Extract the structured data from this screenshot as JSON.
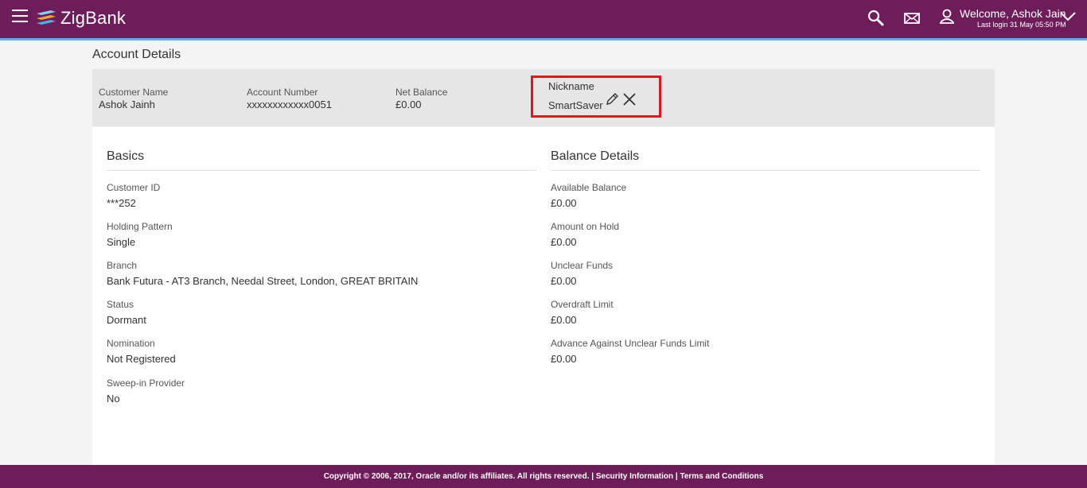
{
  "header": {
    "brand": "ZigBank",
    "welcome": "Welcome, Ashok Jain",
    "last_login": "Last login 31 May 05:50 PM",
    "colors": {
      "bar": "#6f1c5a",
      "accent_line": "#5fb0e8"
    }
  },
  "page": {
    "title": "Account Details"
  },
  "summary": {
    "customer_name_label": "Customer Name",
    "customer_name": "Ashok Jainh",
    "account_number_label": "Account Number",
    "account_number": "xxxxxxxxxxxx0051",
    "net_balance_label": "Net Balance",
    "net_balance": "£0.00",
    "nickname_label": "Nickname",
    "nickname": "SmartSaver"
  },
  "basics": {
    "title": "Basics",
    "fields": [
      {
        "label": "Customer ID",
        "value": "***252"
      },
      {
        "label": "Holding Pattern",
        "value": "Single"
      },
      {
        "label": "Branch",
        "value": "Bank Futura - AT3 Branch, Needal Street, London, GREAT BRITAIN"
      },
      {
        "label": "Status",
        "value": "Dormant"
      },
      {
        "label": "Nomination",
        "value": "Not Registered"
      },
      {
        "label": "Sweep-in Provider",
        "value": "No"
      }
    ]
  },
  "balance": {
    "title": "Balance Details",
    "fields": [
      {
        "label": "Available Balance",
        "value": "£0.00"
      },
      {
        "label": "Amount on Hold",
        "value": "£0.00"
      },
      {
        "label": "Unclear Funds",
        "value": "£0.00"
      },
      {
        "label": "Overdraft Limit",
        "value": "£0.00"
      },
      {
        "label": "Advance Against Unclear Funds Limit",
        "value": "£0.00"
      }
    ]
  },
  "footer": {
    "copyright": "Copyright © 2006, 2017, Oracle and/or its affiliates. All rights reserved.",
    "sep": "|",
    "security": "Security Information",
    "terms": "Terms and Conditions"
  },
  "icons": [
    "hamburger-icon",
    "search-icon",
    "mail-icon",
    "user-icon",
    "chevron-down-icon",
    "pencil-icon",
    "close-icon"
  ]
}
